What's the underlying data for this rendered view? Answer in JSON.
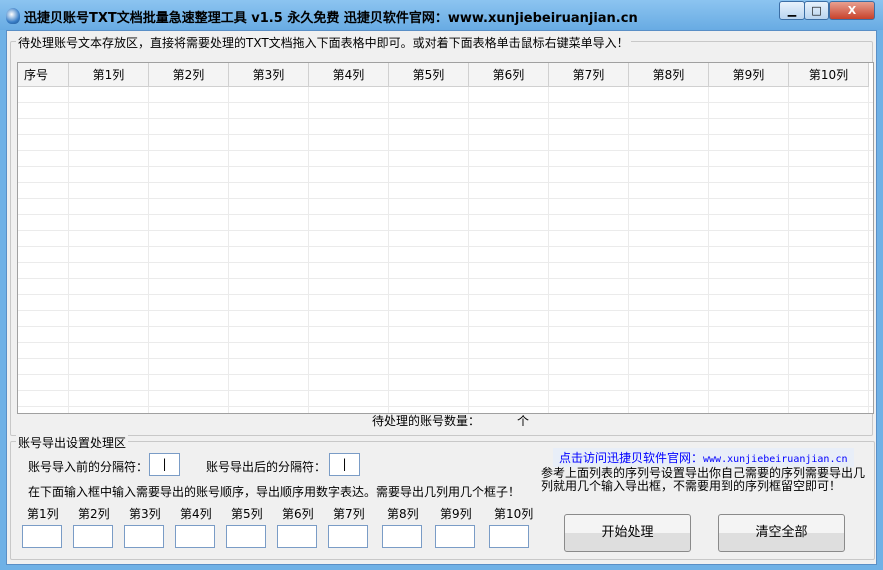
{
  "window": {
    "title": "迅捷贝账号TXT文档批量急速整理工具 v1.5  永久免费  迅捷贝软件官网：www.xunjiebeiruanjian.cn",
    "minimize": "▁",
    "maximize": "□",
    "close": "X"
  },
  "import_area": {
    "group_label": "待处理账号文本存放区，直接将需要处理的TXT文档拖入下面表格中即可。或对着下面表格单击鼠标右键菜单导入！",
    "columns": [
      "序号",
      "第1列",
      "第2列",
      "第3列",
      "第4列",
      "第5列",
      "第6列",
      "第7列",
      "第8列",
      "第9列",
      "第10列"
    ],
    "count_label": "待处理的账号数量：",
    "count_value": "",
    "count_unit": "个"
  },
  "export_area": {
    "group_label": "账号导出设置处理区",
    "sep_before_label": "账号导入前的分隔符：",
    "sep_before_value": "|",
    "sep_after_label": "账号导出后的分隔符：",
    "sep_after_value": "|",
    "instruction": "在下面输入框中输入需要导出的账号顺序，导出顺序用数字表达。需要导出几列用几个框子！",
    "order_labels": [
      "第1列",
      "第2列",
      "第3列",
      "第4列",
      "第5列",
      "第6列",
      "第7列",
      "第8列",
      "第9列",
      "第10列"
    ],
    "order_values": [
      "",
      "",
      "",
      "",
      "",
      "",
      "",
      "",
      "",
      ""
    ],
    "link_text": "点击访问迅捷贝软件官网：",
    "link_url_text": "www.xunjiebeiruanjian.cn",
    "description": "参考上面列表的序列号设置导出你自己需要的序列需要导出几列就用几个输入导出框，不需要用到的序列框留空即可！",
    "start_button": "开始处理",
    "clear_button": "清空全部"
  }
}
